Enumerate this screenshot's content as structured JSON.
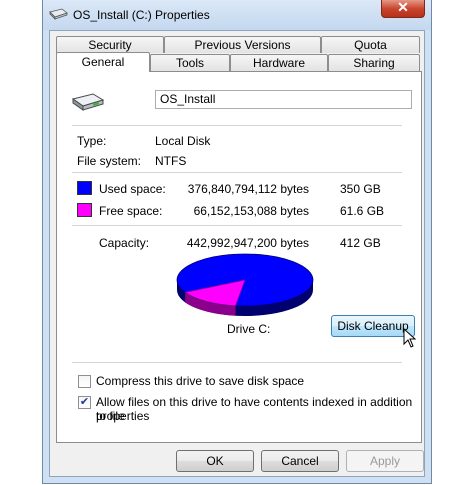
{
  "window": {
    "title": "OS_Install (C:) Properties",
    "close_label": "✕"
  },
  "tabs_back": [
    "Security",
    "Previous Versions",
    "Quota"
  ],
  "tabs_front": [
    "General",
    "Tools",
    "Hardware",
    "Sharing"
  ],
  "general": {
    "drive_name": "OS_Install",
    "type_label": "Type:",
    "type_value": "Local Disk",
    "fs_label": "File system:",
    "fs_value": "NTFS",
    "used": {
      "label": "Used space:",
      "bytes": "376,840,794,112 bytes",
      "size": "350 GB",
      "color": "#0000ff"
    },
    "free": {
      "label": "Free space:",
      "bytes": "66,152,153,088 bytes",
      "size": "61.6 GB",
      "color": "#ff00ff"
    },
    "capacity": {
      "label": "Capacity:",
      "bytes": "442,992,947,200 bytes",
      "size": "412 GB"
    },
    "drive_caption": "Drive C:",
    "disk_cleanup": "Disk Cleanup",
    "compress_label": "Compress this drive to save disk space",
    "compress_checked": false,
    "index_label_1": "Allow files on this drive to have contents indexed in addition to file",
    "index_label_2": "properties",
    "index_checked": true,
    "used_fraction": 0.851
  },
  "buttons": {
    "ok": "OK",
    "cancel": "Cancel",
    "apply": "Apply"
  }
}
